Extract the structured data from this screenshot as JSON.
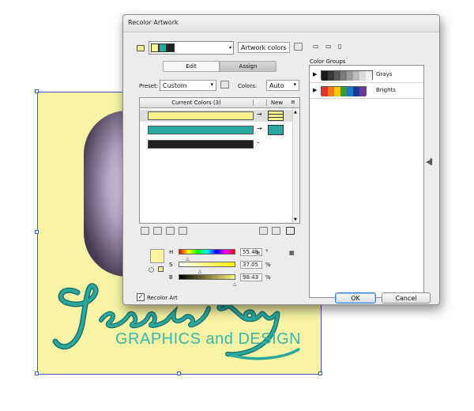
{
  "artwork": {
    "script_text": "Jessie Ray",
    "subtitle": "GRAPHICS and DESIGN",
    "colors": {
      "background": "#f7f3a4",
      "teal": "#2aa79f",
      "dark_teal": "#1d6f6b"
    }
  },
  "dialog": {
    "title": "Recolor Artwork",
    "harmony_swatches": [
      "#f7f38f",
      "#2aa79f",
      "#222222"
    ],
    "artwork_colors_field": "Artwork colors",
    "tabs": [
      {
        "label": "Edit"
      },
      {
        "label": "Assign"
      }
    ],
    "active_tab": "Assign",
    "preset_label": "Preset:",
    "preset_value": "Custom",
    "colors_label": "Colors:",
    "colors_value": "Auto",
    "table": {
      "current_header": "Current Colors (3)",
      "new_header": "New",
      "rows": [
        {
          "color": "#f7f38f",
          "has_new": true,
          "arrow": "→"
        },
        {
          "color": "#2aa79f",
          "has_new": true,
          "arrow": "→"
        },
        {
          "color": "#1f1f1f",
          "has_new": false,
          "arrow": "–"
        }
      ]
    },
    "hsb": {
      "h_label": "H",
      "h_value": "55.48",
      "h_unit": "°",
      "s_label": "S",
      "s_value": "37.05",
      "s_unit": "%",
      "b_label": "B",
      "b_value": "98.43",
      "b_unit": "%",
      "h_fraction": 0.154,
      "s_fraction": 0.3705,
      "b_fraction": 0.9843,
      "preview_color": "#fbf39e"
    },
    "color_groups_label": "Color Groups",
    "color_groups": [
      {
        "name": "Grays",
        "swatches": [
          "#1a1a1a",
          "#3a3a3a",
          "#5a5a5a",
          "#7a7a7a",
          "#9a9a9a",
          "#bababa",
          "#dadada",
          "#f2f2f2"
        ]
      },
      {
        "name": "Brights",
        "swatches": [
          "#e4322a",
          "#f07a1a",
          "#f7c412",
          "#3a9a3a",
          "#1a7ac8",
          "#1a3a9a",
          "#6a3a9a"
        ]
      }
    ],
    "recolor_art_label": "Recolor Art",
    "recolor_art_checked": true,
    "ok_label": "OK",
    "cancel_label": "Cancel"
  }
}
